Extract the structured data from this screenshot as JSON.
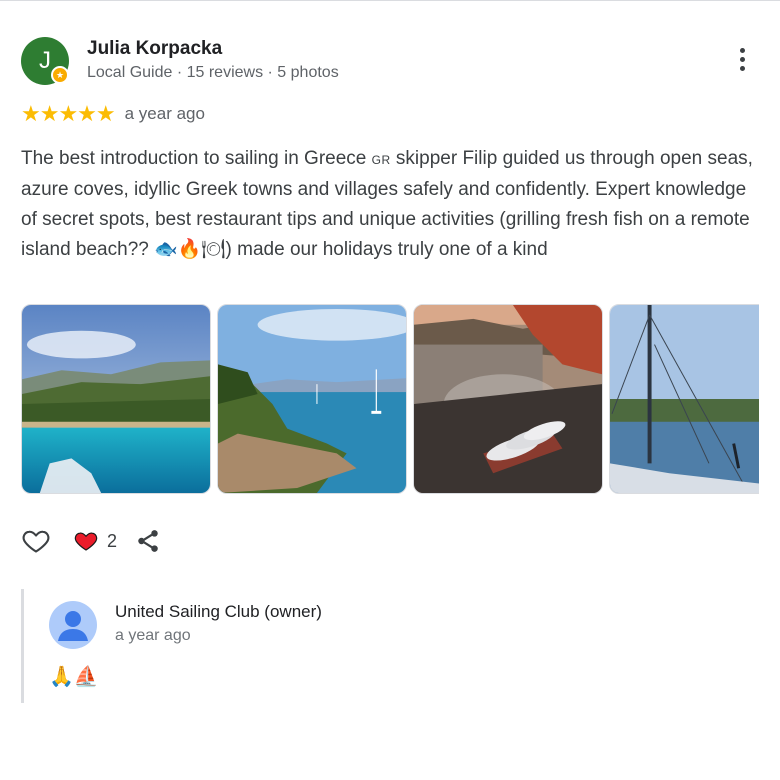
{
  "review": {
    "author": {
      "initial": "J",
      "name": "Julia Korpacka",
      "meta": "Local Guide · 15 reviews · 5 photos"
    },
    "rating": {
      "value": 5,
      "max": 5,
      "stars": "★★★★★"
    },
    "date": "a year ago",
    "text": {
      "part1": "The best introduction to sailing in Greece ",
      "flag": "GR",
      "part2": " skipper Filip guided us through open seas, azure coves, idyllic Greek towns and villages safely and confidently. Expert knowledge of secret spots, best restaurant tips and unique activities (grilling fresh fish on a remote island beach?? ",
      "emoji": "🐟🔥🍽",
      "part3": ") made our holidays truly one of a kind"
    },
    "photos": [
      {
        "name": "photo-coastline-island"
      },
      {
        "name": "photo-bay-sailboats"
      },
      {
        "name": "photo-beach-grill-fish"
      },
      {
        "name": "photo-sailboat-mast"
      }
    ],
    "actions": {
      "like_icon": "heart-outline-icon",
      "liked_icon": "heart-filled-icon",
      "like_count": "2",
      "share_icon": "share-icon"
    }
  },
  "reply": {
    "author": "United Sailing Club (owner)",
    "date": "a year ago",
    "text": "🙏⛵"
  },
  "colors": {
    "avatar": "#2e7d32",
    "star": "#fbbc04",
    "heart": "#ea1c2a",
    "text_secondary": "#5f6368"
  }
}
